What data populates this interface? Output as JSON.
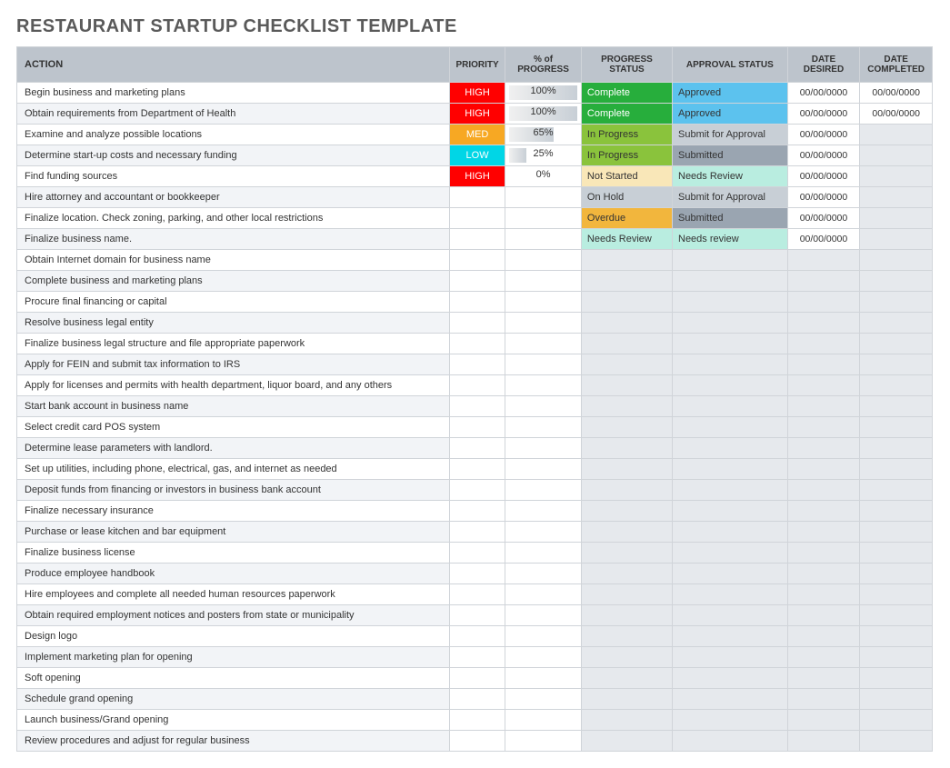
{
  "title": "RESTAURANT STARTUP CHECKLIST TEMPLATE",
  "headers": {
    "action": "ACTION",
    "priority": "PRIORITY",
    "progress": "% of PROGRESS",
    "pstatus": "PROGRESS STATUS",
    "approval": "APPROVAL STATUS",
    "date_desired": "DATE DESIRED",
    "date_completed": "DATE COMPLETED"
  },
  "rows": [
    {
      "action": "Begin business and marketing plans",
      "priority": "HIGH",
      "progress": 100,
      "pstatus": "Complete",
      "approval": "Approved",
      "date_desired": "00/00/0000",
      "date_completed": "00/00/0000"
    },
    {
      "action": "Obtain requirements from Department of Health",
      "priority": "HIGH",
      "progress": 100,
      "pstatus": "Complete",
      "approval": "Approved",
      "date_desired": "00/00/0000",
      "date_completed": "00/00/0000"
    },
    {
      "action": "Examine and analyze possible locations",
      "priority": "MED",
      "progress": 65,
      "pstatus": "In Progress",
      "approval": "Submit for Approval",
      "date_desired": "00/00/0000",
      "date_completed": ""
    },
    {
      "action": "Determine start-up costs and necessary funding",
      "priority": "LOW",
      "progress": 25,
      "pstatus": "In Progress",
      "approval": "Submitted",
      "date_desired": "00/00/0000",
      "date_completed": ""
    },
    {
      "action": "Find funding sources",
      "priority": "HIGH",
      "progress": 0,
      "pstatus": "Not Started",
      "approval": "Needs Review",
      "date_desired": "00/00/0000",
      "date_completed": ""
    },
    {
      "action": "Hire attorney and accountant or bookkeeper",
      "priority": "",
      "progress": null,
      "pstatus": "On Hold",
      "approval": "Submit for Approval",
      "date_desired": "00/00/0000",
      "date_completed": ""
    },
    {
      "action": "Finalize location. Check zoning, parking, and other local restrictions",
      "priority": "",
      "progress": null,
      "pstatus": "Overdue",
      "approval": "Submitted",
      "date_desired": "00/00/0000",
      "date_completed": ""
    },
    {
      "action": "Finalize business name.",
      "priority": "",
      "progress": null,
      "pstatus": "Needs Review",
      "approval": "Needs review",
      "date_desired": "00/00/0000",
      "date_completed": ""
    },
    {
      "action": "Obtain Internet domain for business name",
      "priority": "",
      "progress": null,
      "pstatus": "",
      "approval": "",
      "date_desired": "",
      "date_completed": ""
    },
    {
      "action": "Complete business and marketing plans",
      "priority": "",
      "progress": null,
      "pstatus": "",
      "approval": "",
      "date_desired": "",
      "date_completed": ""
    },
    {
      "action": "Procure final financing or capital",
      "priority": "",
      "progress": null,
      "pstatus": "",
      "approval": "",
      "date_desired": "",
      "date_completed": ""
    },
    {
      "action": "Resolve business legal entity",
      "priority": "",
      "progress": null,
      "pstatus": "",
      "approval": "",
      "date_desired": "",
      "date_completed": ""
    },
    {
      "action": "Finalize business legal structure and file appropriate paperwork",
      "priority": "",
      "progress": null,
      "pstatus": "",
      "approval": "",
      "date_desired": "",
      "date_completed": ""
    },
    {
      "action": "Apply for FEIN and submit tax information to IRS",
      "priority": "",
      "progress": null,
      "pstatus": "",
      "approval": "",
      "date_desired": "",
      "date_completed": ""
    },
    {
      "action": "Apply for licenses and permits with health department, liquor board, and any others",
      "priority": "",
      "progress": null,
      "pstatus": "",
      "approval": "",
      "date_desired": "",
      "date_completed": ""
    },
    {
      "action": "Start bank account in business name",
      "priority": "",
      "progress": null,
      "pstatus": "",
      "approval": "",
      "date_desired": "",
      "date_completed": ""
    },
    {
      "action": "Select credit card POS system",
      "priority": "",
      "progress": null,
      "pstatus": "",
      "approval": "",
      "date_desired": "",
      "date_completed": ""
    },
    {
      "action": "Determine lease parameters with landlord.",
      "priority": "",
      "progress": null,
      "pstatus": "",
      "approval": "",
      "date_desired": "",
      "date_completed": ""
    },
    {
      "action": "Set up utilities, including phone, electrical, gas, and internet as needed",
      "priority": "",
      "progress": null,
      "pstatus": "",
      "approval": "",
      "date_desired": "",
      "date_completed": ""
    },
    {
      "action": "Deposit funds from financing or investors in business bank account",
      "priority": "",
      "progress": null,
      "pstatus": "",
      "approval": "",
      "date_desired": "",
      "date_completed": ""
    },
    {
      "action": "Finalize necessary insurance",
      "priority": "",
      "progress": null,
      "pstatus": "",
      "approval": "",
      "date_desired": "",
      "date_completed": ""
    },
    {
      "action": "Purchase or lease kitchen and bar equipment",
      "priority": "",
      "progress": null,
      "pstatus": "",
      "approval": "",
      "date_desired": "",
      "date_completed": ""
    },
    {
      "action": "Finalize business license",
      "priority": "",
      "progress": null,
      "pstatus": "",
      "approval": "",
      "date_desired": "",
      "date_completed": ""
    },
    {
      "action": "Produce employee handbook",
      "priority": "",
      "progress": null,
      "pstatus": "",
      "approval": "",
      "date_desired": "",
      "date_completed": ""
    },
    {
      "action": "Hire employees and complete all needed human resources paperwork",
      "priority": "",
      "progress": null,
      "pstatus": "",
      "approval": "",
      "date_desired": "",
      "date_completed": ""
    },
    {
      "action": "Obtain required employment notices and posters from state or municipality",
      "priority": "",
      "progress": null,
      "pstatus": "",
      "approval": "",
      "date_desired": "",
      "date_completed": ""
    },
    {
      "action": "Design logo",
      "priority": "",
      "progress": null,
      "pstatus": "",
      "approval": "",
      "date_desired": "",
      "date_completed": ""
    },
    {
      "action": "Implement marketing plan for opening",
      "priority": "",
      "progress": null,
      "pstatus": "",
      "approval": "",
      "date_desired": "",
      "date_completed": ""
    },
    {
      "action": "Soft opening",
      "priority": "",
      "progress": null,
      "pstatus": "",
      "approval": "",
      "date_desired": "",
      "date_completed": ""
    },
    {
      "action": "Schedule grand opening",
      "priority": "",
      "progress": null,
      "pstatus": "",
      "approval": "",
      "date_desired": "",
      "date_completed": ""
    },
    {
      "action": "Launch business/Grand opening",
      "priority": "",
      "progress": null,
      "pstatus": "",
      "approval": "",
      "date_desired": "",
      "date_completed": ""
    },
    {
      "action": "Review procedures and adjust for regular business",
      "priority": "",
      "progress": null,
      "pstatus": "",
      "approval": "",
      "date_desired": "",
      "date_completed": ""
    }
  ]
}
